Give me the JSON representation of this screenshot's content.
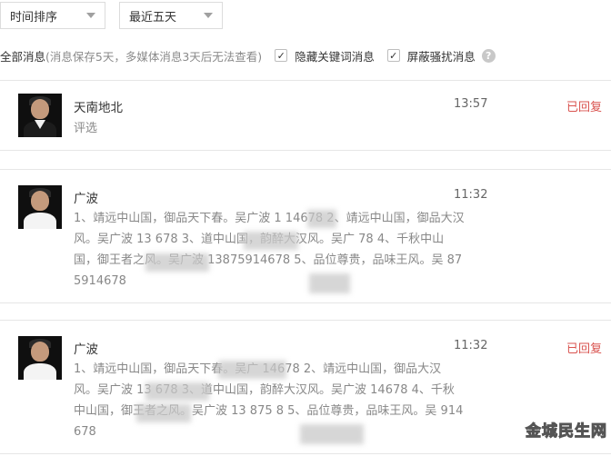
{
  "filters": {
    "sort": "时间排序",
    "range": "最近五天"
  },
  "filterbar": {
    "all_label": "全部消息",
    "note": "(消息保存5天，多媒体消息3天后无法查看)",
    "hide_keyword_label": "隐藏关键词消息",
    "block_harass_label": "屏蔽骚扰消息",
    "check_mark": "✓",
    "help_mark": "?"
  },
  "messages": [
    {
      "name": "天南地北",
      "time": "13:57",
      "status": "已回复",
      "content": "评选"
    },
    {
      "name": "广波",
      "time": "11:32",
      "status": "",
      "content": "1、靖远中山国，御品天下春。吴广波 1      14678 2、靖远中山国，御品大汉风。吴广波 13      678 3、道中山国，韵醉大汉风。吴广      78 4、千秋中山国，御王者之风。吴广波 13875914678 5、品位尊贵，品味王风。吴      875914678"
    },
    {
      "name": "广波",
      "time": "11:32",
      "status": "已回复",
      "content": "1、靖远中山国，御品天下春。吴广      14678 2、靖远中山国，御品大汉风。吴广波 13      678 3、道中山国，韵醉大汉风。吴广波      14678 4、千秋中山国，御王者之风。吴广波 13 875      8 5、品位尊贵，品味王风。吴      914678"
    }
  ],
  "watermark": "金城民生网",
  "colors": {
    "reply": "#d9534f",
    "border": "#e6e6e6"
  }
}
